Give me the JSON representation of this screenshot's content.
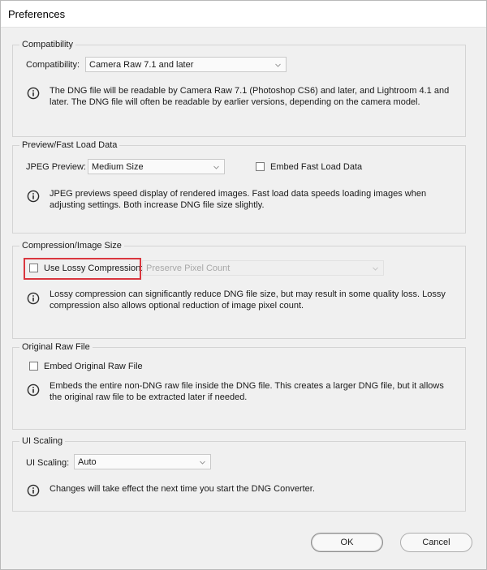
{
  "window": {
    "title": "Preferences"
  },
  "compatibility": {
    "group_title": "Compatibility",
    "label": "Compatibility:",
    "selected": "Camera Raw 7.1 and later",
    "info": "The DNG file will be readable by Camera Raw 7.1 (Photoshop CS6) and later, and Lightroom 4.1 and later. The DNG file will often be readable by earlier versions, depending on the camera model."
  },
  "preview": {
    "group_title": "Preview/Fast Load Data",
    "label": "JPEG Preview:",
    "selected": "Medium Size",
    "embed_label": "Embed Fast Load Data",
    "embed_checked": false,
    "info": "JPEG previews speed display of rendered images.  Fast load data speeds loading images when adjusting settings.  Both increase DNG file size slightly."
  },
  "compression": {
    "group_title": "Compression/Image Size",
    "lossy_label": "Use Lossy Compression:",
    "lossy_checked": false,
    "selected": "Preserve Pixel Count",
    "info": "Lossy compression can significantly reduce DNG file size, but may result in some quality loss.  Lossy compression also allows optional reduction of image pixel count."
  },
  "original_raw": {
    "group_title": "Original Raw File",
    "embed_label": "Embed Original Raw File",
    "embed_checked": false,
    "info": "Embeds the entire non-DNG raw file inside the DNG file.  This creates a larger DNG file, but it allows the original raw file to be extracted later if needed."
  },
  "ui_scaling": {
    "group_title": "UI Scaling",
    "label": "UI Scaling:",
    "selected": "Auto",
    "info": "Changes will take effect the next time you start the DNG Converter."
  },
  "buttons": {
    "ok": "OK",
    "cancel": "Cancel"
  },
  "colors": {
    "highlight": "#d9363e"
  }
}
